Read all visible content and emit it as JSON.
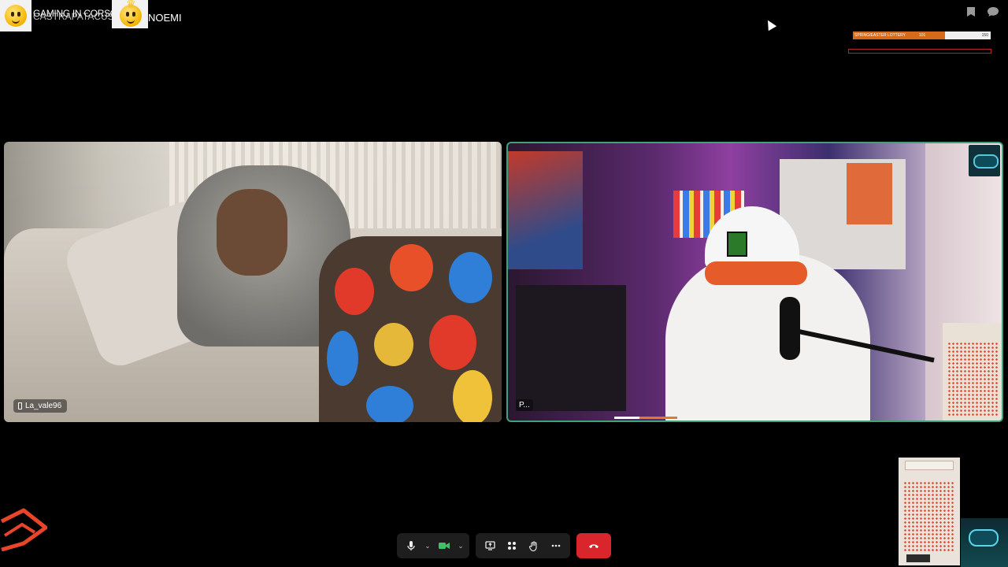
{
  "overlay": {
    "line1": "GAMING IN CORSO",
    "line2": "CASTRAPATACUS",
    "guest_name": "NOEMI"
  },
  "lottery": {
    "label": "SPRING/EASTER LOTTERY",
    "current": "101",
    "max": "150",
    "progress_fraction": 0.67,
    "fill_color": "#d46a1a"
  },
  "tiles": {
    "left": {
      "participant_name": "La_vale96",
      "device_icon": "phone-icon"
    },
    "right": {
      "participant_name": "P...",
      "active_speaker_color": "#3fa27a"
    }
  },
  "toolbar": {
    "mic_icon": "microphone-icon",
    "camera_icon": "camera-icon",
    "share_icon": "screen-share-icon",
    "apps_icon": "apps-icon",
    "raise_hand_icon": "raise-hand-icon",
    "more_icon": "more-icon",
    "hangup_icon": "hangup-icon",
    "hangup_color": "#d8262c",
    "camera_color": "#3fc06a"
  },
  "top_right_icons": [
    "bookmark-icon",
    "chat-icon"
  ]
}
